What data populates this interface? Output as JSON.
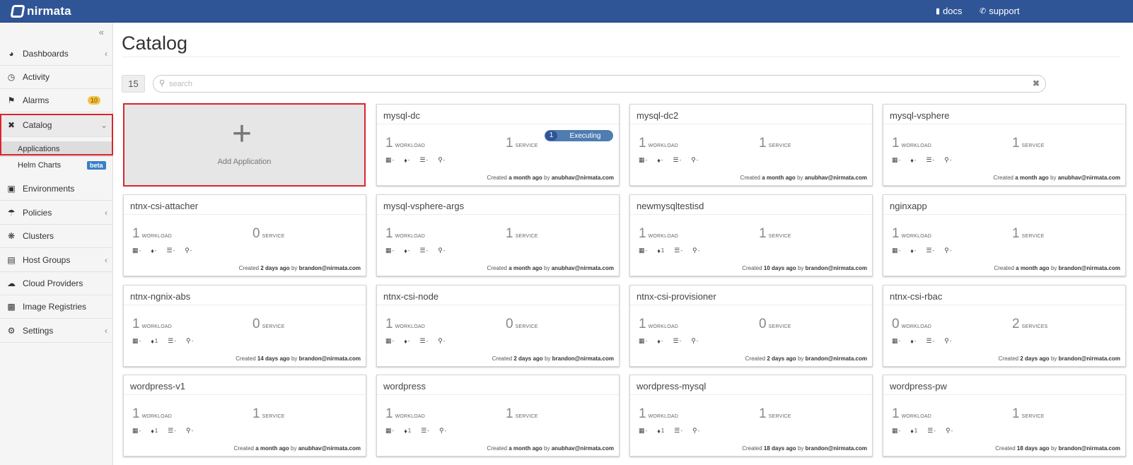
{
  "header": {
    "brand": "nirmata",
    "docs_label": "docs",
    "support_label": "support"
  },
  "sidebar": {
    "collapse_glyph": "«",
    "items": [
      {
        "label": "Dashboards",
        "icon": "dashboard-icon"
      },
      {
        "label": "Activity",
        "icon": "activity-icon"
      },
      {
        "label": "Alarms",
        "icon": "bell-icon",
        "badge": "10"
      },
      {
        "label": "Catalog",
        "icon": "catalog-icon"
      },
      {
        "label": "Environments",
        "icon": "environments-icon"
      },
      {
        "label": "Policies",
        "icon": "umbrella-icon"
      },
      {
        "label": "Clusters",
        "icon": "clusters-icon"
      },
      {
        "label": "Host Groups",
        "icon": "host-groups-icon"
      },
      {
        "label": "Cloud Providers",
        "icon": "cloud-icon"
      },
      {
        "label": "Image Registries",
        "icon": "registry-icon"
      },
      {
        "label": "Settings",
        "icon": "gears-icon"
      }
    ],
    "catalog_sub": [
      {
        "label": "Applications"
      },
      {
        "label": "Helm Charts",
        "badge": "beta"
      }
    ]
  },
  "main": {
    "title": "Catalog",
    "count": "15",
    "search_placeholder": "search",
    "add_label": "Add Application"
  },
  "cards": [
    {
      "name": "mysql-dc",
      "workloads": "1",
      "workload_label": "WORKLOAD",
      "services": "1",
      "service_label": "SERVICE",
      "routes": "-",
      "time": "a month ago",
      "user": "anubhav@nirmata.com",
      "executing": "Executing",
      "exec_count": "1"
    },
    {
      "name": "mysql-dc2",
      "workloads": "1",
      "workload_label": "WORKLOAD",
      "services": "1",
      "service_label": "SERVICE",
      "routes": "-",
      "time": "a month ago",
      "user": "anubhav@nirmata.com"
    },
    {
      "name": "mysql-vsphere",
      "workloads": "1",
      "workload_label": "WORKLOAD",
      "services": "1",
      "service_label": "SERVICE",
      "routes": "-",
      "time": "a month ago",
      "user": "anubhav@nirmata.com"
    },
    {
      "name": "ntnx-csi-attacher",
      "workloads": "1",
      "workload_label": "WORKLOAD",
      "services": "0",
      "service_label": "SERVICE",
      "routes": "-",
      "time": "2 days ago",
      "user": "brandon@nirmata.com"
    },
    {
      "name": "mysql-vsphere-args",
      "workloads": "1",
      "workload_label": "WORKLOAD",
      "services": "1",
      "service_label": "SERVICE",
      "routes": "-",
      "time": "a month ago",
      "user": "anubhav@nirmata.com"
    },
    {
      "name": "newmysqltestisd",
      "workloads": "1",
      "workload_label": "WORKLOAD",
      "services": "1",
      "service_label": "SERVICE",
      "routes": "1",
      "time": "10 days ago",
      "user": "brandon@nirmata.com"
    },
    {
      "name": "nginxapp",
      "workloads": "1",
      "workload_label": "WORKLOAD",
      "services": "1",
      "service_label": "SERVICE",
      "routes": "-",
      "time": "a month ago",
      "user": "brandon@nirmata.com"
    },
    {
      "name": "ntnx-ngnix-abs",
      "workloads": "1",
      "workload_label": "WORKLOAD",
      "services": "0",
      "service_label": "SERVICE",
      "routes": "1",
      "time": "14 days ago",
      "user": "brandon@nirmata.com"
    },
    {
      "name": "ntnx-csi-node",
      "workloads": "1",
      "workload_label": "WORKLOAD",
      "services": "0",
      "service_label": "SERVICE",
      "routes": "-",
      "time": "2 days ago",
      "user": "brandon@nirmata.com"
    },
    {
      "name": "ntnx-csi-provisioner",
      "workloads": "1",
      "workload_label": "WORKLOAD",
      "services": "0",
      "service_label": "SERVICE",
      "routes": "-",
      "time": "2 days ago",
      "user": "brandon@nirmata.com"
    },
    {
      "name": "ntnx-csi-rbac",
      "workloads": "0",
      "workload_label": "WORKLOAD",
      "services": "2",
      "service_label": "SERVICES",
      "routes": "-",
      "time": "2 days ago",
      "user": "brandon@nirmata.com"
    },
    {
      "name": "wordpress-v1",
      "workloads": "1",
      "workload_label": "WORKLOAD",
      "services": "1",
      "service_label": "SERVICE",
      "routes": "1",
      "time": "a month ago",
      "user": "anubhav@nirmata.com"
    },
    {
      "name": "wordpress",
      "workloads": "1",
      "workload_label": "WORKLOAD",
      "services": "1",
      "service_label": "SERVICE",
      "routes": "1",
      "time": "a month ago",
      "user": "anubhav@nirmata.com"
    },
    {
      "name": "wordpress-mysql",
      "workloads": "1",
      "workload_label": "WORKLOAD",
      "services": "1",
      "service_label": "SERVICE",
      "routes": "1",
      "time": "18 days ago",
      "user": "brandon@nirmata.com"
    },
    {
      "name": "wordpress-pw",
      "workloads": "1",
      "workload_label": "WORKLOAD",
      "services": "1",
      "service_label": "SERVICE",
      "routes": "1",
      "time": "18 days ago",
      "user": "brandon@nirmata.com"
    }
  ],
  "card_text": {
    "created_prefix": "Created",
    "by": "by",
    "dash": "-"
  },
  "colors": {
    "header": "#2f5597",
    "highlight": "#d9262c",
    "alarm_badge": "#f5c242",
    "beta_badge": "#3a7fc6",
    "executing": "#4f7cb1"
  }
}
